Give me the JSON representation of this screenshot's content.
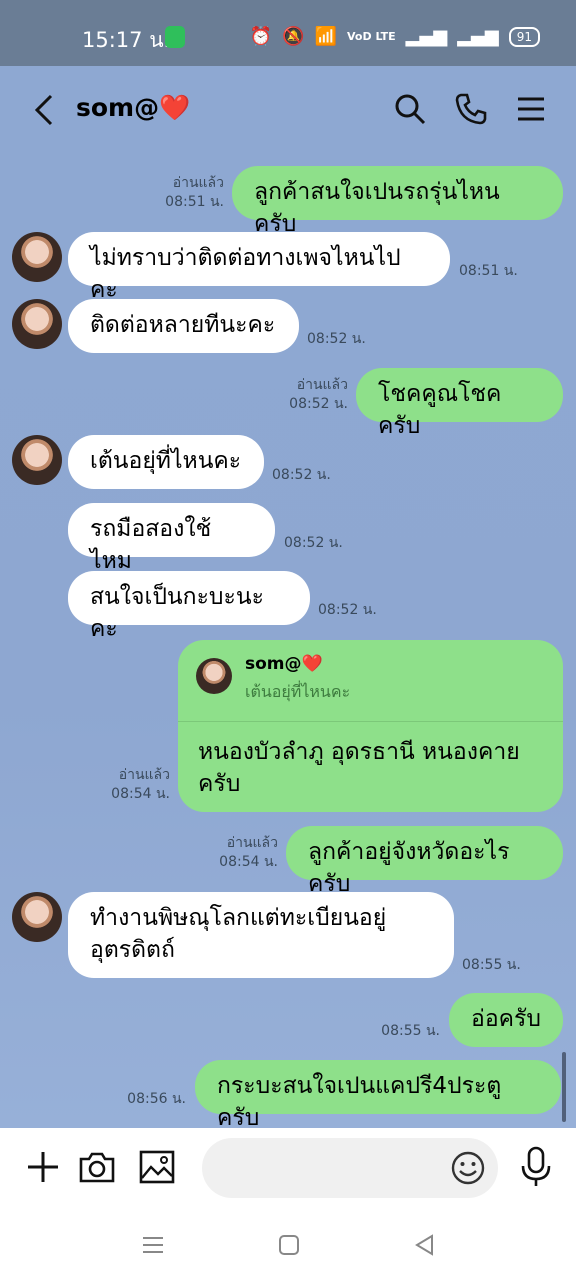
{
  "status_bar": {
    "time": "15:17 น.",
    "network_label": "VoD LTE",
    "battery": "91"
  },
  "header": {
    "chat_name": "som@❤️"
  },
  "messages": [
    {
      "direction": "out",
      "text": "ลูกค้าสนใจเปนรถรุ่นไหนครับ",
      "read": "อ่านแล้ว",
      "time": "08:51 น."
    },
    {
      "direction": "in",
      "text": "ไม่ทราบว่าติดต่อทางเพจไหนไปคะ",
      "time": "08:51 น."
    },
    {
      "direction": "in",
      "text": "ติดต่อหลายทีนะคะ",
      "time": "08:52 น."
    },
    {
      "direction": "out",
      "text": "โชคคูณโชคครับ",
      "read": "อ่านแล้ว",
      "time": "08:52 น."
    },
    {
      "direction": "in",
      "text": "เต้นอยุ่ที่ไหนคะ",
      "time": "08:52 น."
    },
    {
      "direction": "in",
      "text": "รถมือสองใช้ไหม",
      "time": "08:52 น."
    },
    {
      "direction": "in",
      "text": "สนใจเป็นกะบะนะคะ",
      "time": "08:52 น."
    },
    {
      "direction": "out",
      "text": "หนองบัวลำภู อุดรธานี หนองคาย ครับ",
      "read": "อ่านแล้ว",
      "time": "08:54 น.",
      "reply_to_name": "som@❤️",
      "reply_to_text": "เต้นอยุ่ที่ไหนคะ"
    },
    {
      "direction": "out",
      "text": "ลูกค้าอยู่จังหวัดอะไรครับ",
      "read": "อ่านแล้ว",
      "time": "08:54 น."
    },
    {
      "direction": "in",
      "text": "ทำงานพิษณุโลกแต่ทะเบียนอยู่ อุตรดิตถ์",
      "time": "08:55 น."
    },
    {
      "direction": "out",
      "text": "อ่อครับ",
      "time": "08:55 น."
    },
    {
      "direction": "out",
      "text": "กระบะสนใจเปนแคปรี4ประตูครับ",
      "time": "08:56 น."
    }
  ],
  "input": {
    "placeholder": ""
  }
}
